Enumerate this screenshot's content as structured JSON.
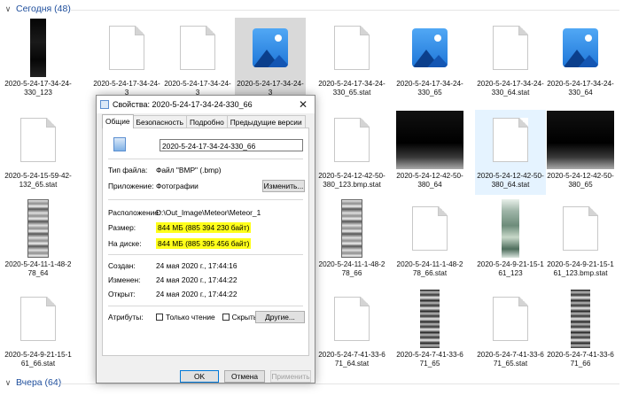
{
  "groups": {
    "today": "Сегодня (48)",
    "week": "Вчера (64)"
  },
  "files": [
    {
      "name": "2020-5-24-17-34-24-330_123"
    },
    {
      "name": "2020-5-24-17-34-24-3"
    },
    {
      "name": "2020-5-24-17-34-24-3"
    },
    {
      "name": "2020-5-24-17-34-24-3"
    },
    {
      "name": "2020-5-24-17-34-24-330_65.stat"
    },
    {
      "name": "2020-5-24-17-34-24-330_65"
    },
    {
      "name": "2020-5-24-17-34-24-330_64.stat"
    },
    {
      "name": "2020-5-24-17-34-24-330_64"
    },
    {
      "name": "2020-5-24-15-59-42-132_65.stat"
    },
    {
      "name": "2020-5-24-12-42-50-380_123.bmp.stat"
    },
    {
      "name": "2020-5-24-12-42-50-380_64"
    },
    {
      "name": "2020-5-24-12-42-50-380_64.stat"
    },
    {
      "name": "2020-5-24-12-42-50-380_65"
    },
    {
      "name": "2020-5-24-11-1-48-278_64"
    },
    {
      "name": "2020-5-24-11-1-48-278_66"
    },
    {
      "name": "2020-5-24-11-1-48-278_66.stat"
    },
    {
      "name": "2020-5-24-9-21-15-161_123"
    },
    {
      "name": "2020-5-24-9-21-15-161_123.bmp.stat"
    },
    {
      "name": "2020-5-24-9-21-15-161_66.stat"
    },
    {
      "name": "2020-5-24-7-41-33-671_64.stat"
    },
    {
      "name": "2020-5-24-7-41-33-671_65"
    },
    {
      "name": "2020-5-24-7-41-33-671_65.stat"
    },
    {
      "name": "2020-5-24-7-41-33-671_66"
    }
  ],
  "dialog": {
    "title": "Свойства: 2020-5-24-17-34-24-330_66",
    "tabs": [
      "Общие",
      "Безопасность",
      "Подробно",
      "Предыдущие версии"
    ],
    "file_name": "2020-5-24-17-34-24-330_66",
    "type_label": "Тип файла:",
    "type_value": "Файл \"BMP\" (.bmp)",
    "app_label": "Приложение:",
    "app_value": "Фотографии",
    "change_button": "Изменить...",
    "location_label": "Расположение:",
    "location_value": "D:\\Out_Image\\Meteor\\Meteor_1",
    "size_label": "Размер:",
    "size_value": "844 МБ (885 394 230 байт)",
    "disk_label": "На диске:",
    "disk_value": "844 МБ (885 395 456 байт)",
    "created_label": "Создан:",
    "created_value": "24 мая 2020 г., 17:44:16",
    "modified_label": "Изменен:",
    "modified_value": "24 мая 2020 г., 17:44:22",
    "opened_label": "Открыт:",
    "opened_value": "24 мая 2020 г., 17:44:22",
    "attributes_label": "Атрибуты:",
    "readonly_label": "Только чтение",
    "hidden_label": "Скрытый",
    "other_button": "Другие...",
    "ok_button": "OK",
    "cancel_button": "Отмена",
    "apply_button": "Применить"
  }
}
